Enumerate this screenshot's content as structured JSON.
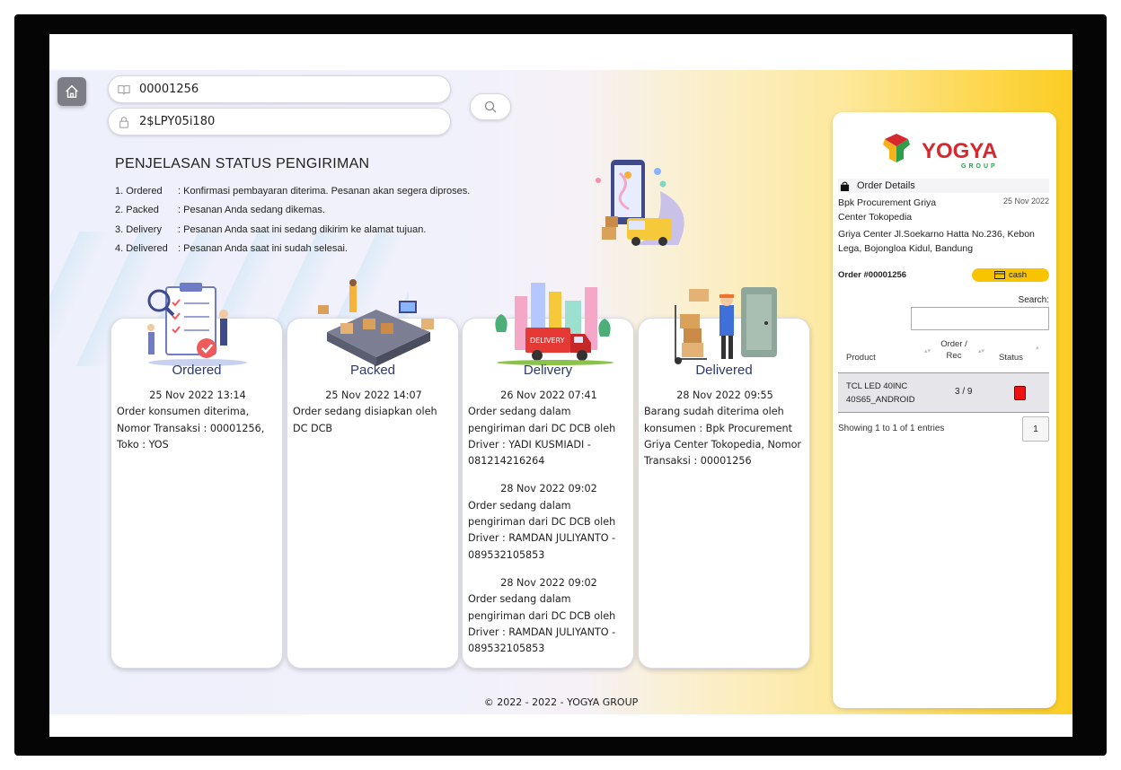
{
  "login": {
    "order_value": "00001256",
    "code_value": "2$LPY05i180"
  },
  "status_info": {
    "title": "PENJELASAN STATUS PENGIRIMAN",
    "items": [
      {
        "key": "1. Ordered",
        "desc": ": Konfirmasi pembayaran diterima. Pesanan akan segera diproses."
      },
      {
        "key": "2. Packed",
        "desc": ": Pesanan Anda sedang dikemas."
      },
      {
        "key": "3. Delivery",
        "desc": ": Pesanan Anda saat ini sedang dikirim ke alamat tujuan."
      },
      {
        "key": "4. Delivered",
        "desc": ": Pesanan Anda saat ini sudah selesai."
      }
    ]
  },
  "cards": [
    {
      "title": "Ordered",
      "events": [
        {
          "time": "25 Nov 2022 13:14",
          "text": "Order konsumen diterima, Nomor Transaksi : 00001256, Toko : YOS"
        }
      ]
    },
    {
      "title": "Packed",
      "events": [
        {
          "time": "25 Nov 2022 14:07",
          "text": "Order sedang disiapkan oleh DC DCB"
        }
      ]
    },
    {
      "title": "Delivery",
      "events": [
        {
          "time": "26 Nov 2022 07:41",
          "text": "Order sedang dalam pengiriman dari DC DCB oleh Driver : YADI KUSMIADI - 081214216264"
        },
        {
          "time": "28 Nov 2022 09:02",
          "text": "Order sedang dalam pengiriman dari DC DCB oleh Driver : RAMDAN JULIYANTO - 089532105853"
        },
        {
          "time": "28 Nov 2022 09:02",
          "text": "Order sedang dalam pengiriman dari DC DCB oleh Driver : RAMDAN JULIYANTO - 089532105853"
        }
      ]
    },
    {
      "title": "Delivered",
      "events": [
        {
          "time": "28 Nov 2022 09:55",
          "text": "Barang sudah diterima oleh konsumen : Bpk Procurement Griya Center Tokopedia, Nomor Transaksi : 00001256"
        }
      ]
    }
  ],
  "footer": "© 2022 - 2022 - YOGYA GROUP",
  "panel": {
    "logo_text": "YOGYA",
    "logo_sub": "GROUP",
    "order_details_label": "Order Details",
    "customer": "Bpk Procurement Griya Center Tokopedia",
    "date": "25 Nov 2022",
    "address": "Griya Center Jl.Soekarno Hatta No.236, Kebon Lega, Bojongloa Kidul, Bandung",
    "order_no": "Order #00001256",
    "payment": "cash",
    "search_label": "Search:",
    "col_product": "Product",
    "col_order_rec": "Order / Rec",
    "col_status": "Status",
    "rows": [
      {
        "product": "TCL LED 40INC 40S65_ANDROID",
        "qty": "3 / 9"
      }
    ],
    "showing": "Showing 1 to 1 of 1 entries",
    "page": "1"
  },
  "colors": {
    "accent": "#f8c400",
    "status_red": "#e11111",
    "title_blue": "#2c3a66"
  }
}
